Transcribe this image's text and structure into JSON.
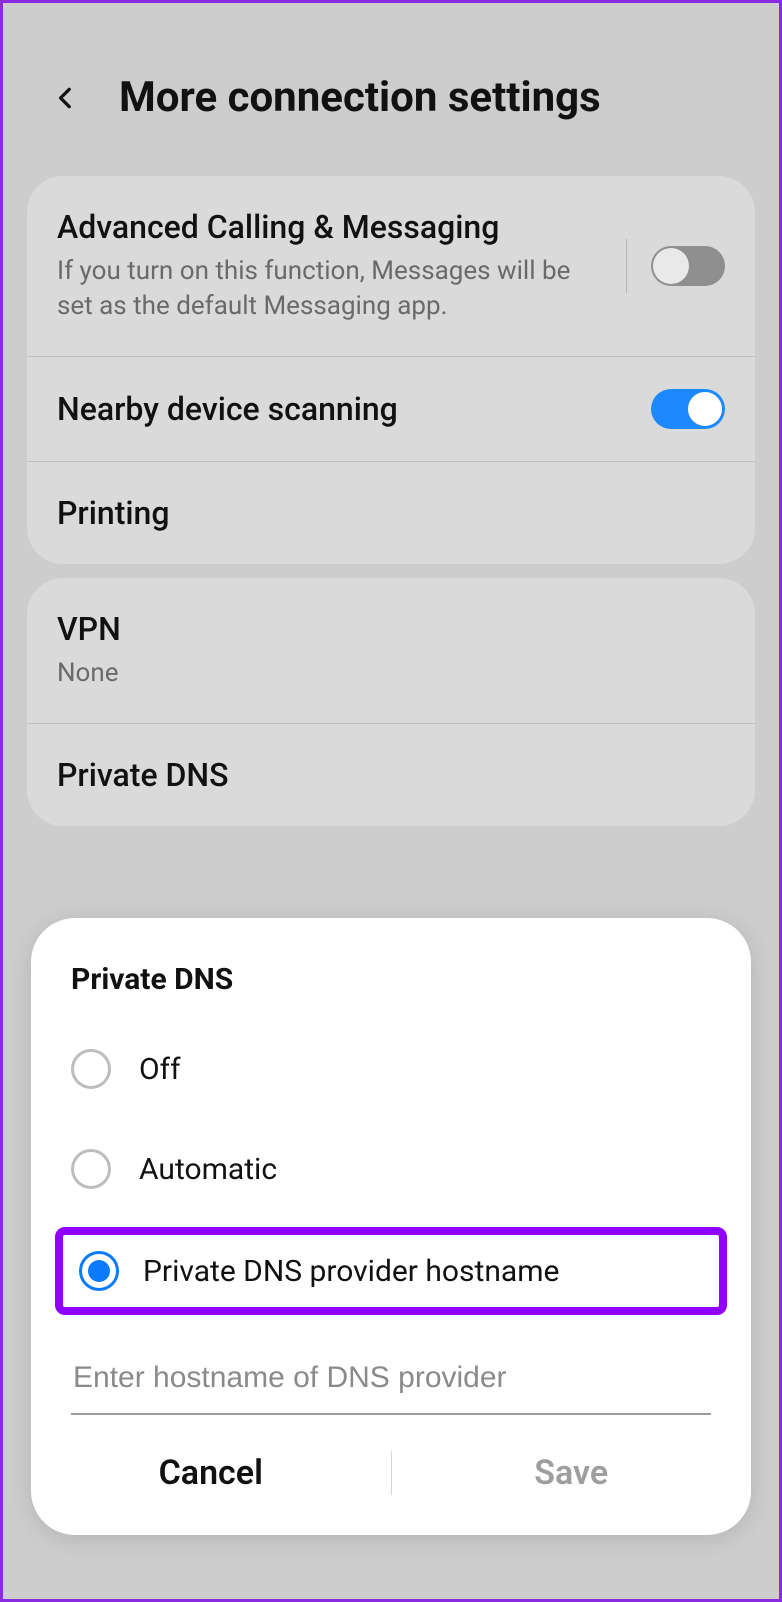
{
  "header": {
    "title": "More connection settings"
  },
  "card1": {
    "advanced_calling": {
      "title": "Advanced Calling & Messaging",
      "sub": "If you turn on this function, Messages will be set as the default Messaging app.",
      "enabled": false
    },
    "nearby": {
      "title": "Nearby device scanning",
      "enabled": true
    },
    "printing": {
      "title": "Printing"
    }
  },
  "card2": {
    "vpn": {
      "title": "VPN",
      "sub": "None"
    },
    "private_dns": {
      "title": "Private DNS"
    }
  },
  "dialog": {
    "title": "Private DNS",
    "options": {
      "off": "Off",
      "auto": "Automatic",
      "hostname": "Private DNS provider hostname"
    },
    "selected": "hostname",
    "input_placeholder": "Enter hostname of DNS provider",
    "input_value": "",
    "cancel": "Cancel",
    "save": "Save"
  }
}
